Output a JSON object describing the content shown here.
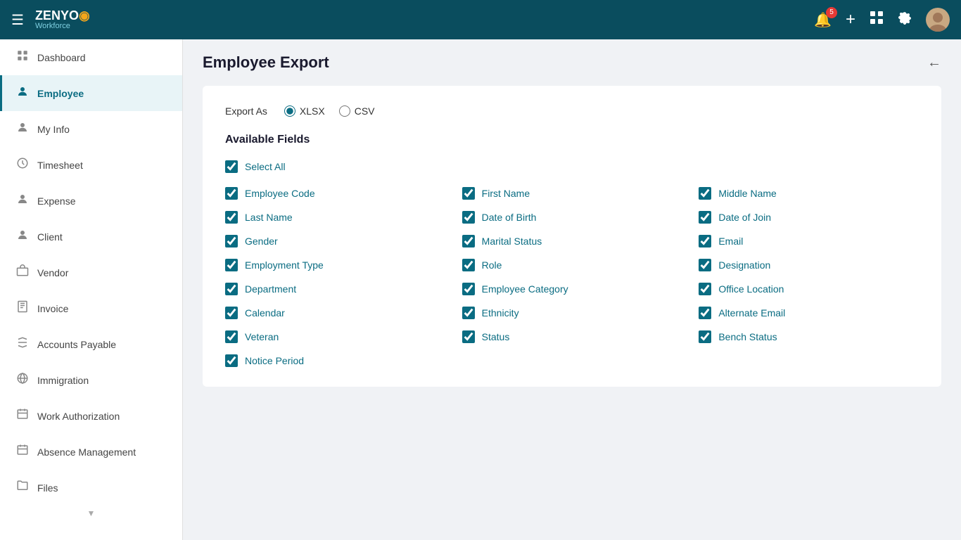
{
  "topnav": {
    "logo_zenyo": "ZENYO",
    "logo_mark": "⊙",
    "logo_workforce": "Workforce",
    "notification_count": "5",
    "add_label": "+",
    "grid_label": "⊞",
    "settings_label": "⚙"
  },
  "sidebar": {
    "items": [
      {
        "id": "dashboard",
        "label": "Dashboard",
        "icon": "🏠",
        "active": false
      },
      {
        "id": "employee",
        "label": "Employee",
        "icon": "👤",
        "active": true
      },
      {
        "id": "myinfo",
        "label": "My Info",
        "icon": "👤",
        "active": false
      },
      {
        "id": "timesheet",
        "label": "Timesheet",
        "icon": "🕐",
        "active": false
      },
      {
        "id": "expense",
        "label": "Expense",
        "icon": "👤",
        "active": false
      },
      {
        "id": "client",
        "label": "Client",
        "icon": "👤",
        "active": false
      },
      {
        "id": "vendor",
        "label": "Vendor",
        "icon": "🏢",
        "active": false
      },
      {
        "id": "invoice",
        "label": "Invoice",
        "icon": "🗒",
        "active": false
      },
      {
        "id": "accounts-payable",
        "label": "Accounts Payable",
        "icon": "🔄",
        "active": false
      },
      {
        "id": "immigration",
        "label": "Immigration",
        "icon": "🌐",
        "active": false
      },
      {
        "id": "work-authorization",
        "label": "Work Authorization",
        "icon": "📋",
        "active": false
      },
      {
        "id": "absence-management",
        "label": "Absence Management",
        "icon": "📋",
        "active": false
      },
      {
        "id": "files",
        "label": "Files",
        "icon": "📁",
        "active": false
      }
    ]
  },
  "page": {
    "title": "Employee Export",
    "export_label": "Export As",
    "export_options": [
      {
        "id": "xlsx",
        "label": "XLSX",
        "checked": true
      },
      {
        "id": "csv",
        "label": "CSV",
        "checked": false
      }
    ],
    "available_fields_label": "Available Fields",
    "select_all_label": "Select All",
    "fields": [
      {
        "id": "employee-code",
        "label": "Employee Code",
        "checked": true
      },
      {
        "id": "first-name",
        "label": "First Name",
        "checked": true
      },
      {
        "id": "middle-name",
        "label": "Middle Name",
        "checked": true
      },
      {
        "id": "last-name",
        "label": "Last Name",
        "checked": true
      },
      {
        "id": "date-of-birth",
        "label": "Date of Birth",
        "checked": true
      },
      {
        "id": "date-of-join",
        "label": "Date of Join",
        "checked": true
      },
      {
        "id": "gender",
        "label": "Gender",
        "checked": true
      },
      {
        "id": "marital-status",
        "label": "Marital Status",
        "checked": true
      },
      {
        "id": "email",
        "label": "Email",
        "checked": true
      },
      {
        "id": "employment-type",
        "label": "Employment Type",
        "checked": true
      },
      {
        "id": "role",
        "label": "Role",
        "checked": true
      },
      {
        "id": "designation",
        "label": "Designation",
        "checked": true
      },
      {
        "id": "department",
        "label": "Department",
        "checked": true
      },
      {
        "id": "employee-category",
        "label": "Employee Category",
        "checked": true
      },
      {
        "id": "office-location",
        "label": "Office Location",
        "checked": true
      },
      {
        "id": "calendar",
        "label": "Calendar",
        "checked": true
      },
      {
        "id": "ethnicity",
        "label": "Ethnicity",
        "checked": true
      },
      {
        "id": "alternate-email",
        "label": "Alternate Email",
        "checked": true
      },
      {
        "id": "veteran",
        "label": "Veteran",
        "checked": true
      },
      {
        "id": "status",
        "label": "Status",
        "checked": true
      },
      {
        "id": "bench-status",
        "label": "Bench Status",
        "checked": true
      },
      {
        "id": "notice-period",
        "label": "Notice Period",
        "checked": true
      }
    ]
  }
}
